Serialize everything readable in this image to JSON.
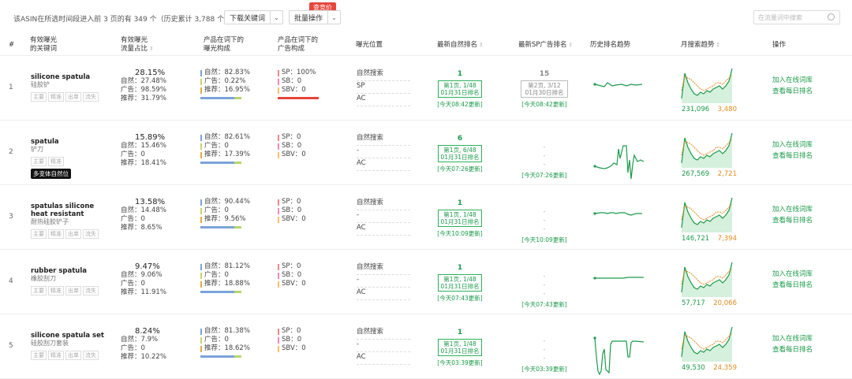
{
  "header": {
    "summary": "该ASIN在所选时间段进入前 3 页的有 349 个（历史累计 3,788 个）",
    "download_label": "下载关键词",
    "batch_label": "批量操作",
    "red_badge": "查竞价",
    "search_placeholder": "在流量词中搜索"
  },
  "columns": {
    "idx": "#",
    "kw_l1": "有效曝光",
    "kw_l2": "的关键词",
    "share_l1": "有效曝光",
    "share_l2": "流量占比",
    "natcomp_l1": "产品在词下的",
    "natcomp_l2": "曝光构成",
    "adcomp_l1": "产品在词下的",
    "adcomp_l2": "广告构成",
    "position": "曝光位置",
    "latest_rank": "最新自然排名",
    "latest_sp": "最新SP广告排名",
    "history": "历史排名趋势",
    "monthly": "月搜索趋势",
    "ops": "操作"
  },
  "colors": {
    "green": "#2bb15a",
    "orange": "#e28a1f",
    "blue": "#7ba3d8",
    "red": "#e8453c"
  },
  "rows": [
    {
      "idx": "1",
      "en": "silicone spatula",
      "cn": "硅胶铲",
      "tags": [
        "主要",
        "精准",
        "出单",
        "流失"
      ],
      "badge": "",
      "share": "28.15%",
      "s_nat": "自然：27.48%",
      "s_ad": "广告：98.59%",
      "s_rec": "推荐：31.79%",
      "n_nat": "自然：82.83%",
      "n_ad": "广告：0.22%",
      "n_rec": "推荐：16.95%",
      "a_sp": "SP：100%",
      "a_sb": "SB：0",
      "a_sbv": "SBV：0",
      "pos1": "自然搜索",
      "pos2": "SP",
      "pos3": "AC",
      "rank_n": "1",
      "rank_box1": "第1页, 1/48",
      "rank_box2": "01月31日排名",
      "rank_upd": "[今天08:42更新]",
      "ad_n": "15",
      "ad_box1": "第2页, 3/12",
      "ad_box2": "01月30日排名",
      "ad_d1": "",
      "ad_d2": "",
      "ad_upd": "[今天08:42更新]",
      "m_a": "231,096",
      "m_b": "3,480",
      "op1": "加入在线词库",
      "op2": "查看每日排名"
    },
    {
      "idx": "2",
      "en": "spatula",
      "cn": "铲刀",
      "tags": [
        "主要",
        "精准"
      ],
      "badge": "多变体自然位",
      "share": "15.89%",
      "s_nat": "自然：15.46%",
      "s_ad": "广告：0",
      "s_rec": "推荐：18.41%",
      "n_nat": "自然：82.61%",
      "n_ad": "广告：0",
      "n_rec": "推荐：17.39%",
      "a_sp": "SP：0",
      "a_sb": "SB：0",
      "a_sbv": "SBV：0",
      "pos1": "自然搜索",
      "pos2": "-",
      "pos3": "AC",
      "rank_n": "6",
      "rank_box1": "第1页, 6/48",
      "rank_box2": "01月31日排名",
      "rank_upd": "[今天07:26更新]",
      "ad_n": "",
      "ad_box1": "",
      "ad_box2": "",
      "ad_d1": "-",
      "ad_d2": "-",
      "ad_upd": "[今天07:26更新]",
      "m_a": "267,569",
      "m_b": "2,721",
      "op1": "加入在线词库",
      "op2": "查看每日排名"
    },
    {
      "idx": "3",
      "en": "spatulas silicone heat resistant",
      "cn": "耐热硅胶铲子",
      "tags": [
        "主要",
        "精准",
        "出单",
        "流失"
      ],
      "badge": "",
      "share": "13.58%",
      "s_nat": "自然：14.48%",
      "s_ad": "广告：0",
      "s_rec": "推荐：8.65%",
      "n_nat": "自然：90.44%",
      "n_ad": "广告：0",
      "n_rec": "推荐：9.56%",
      "a_sp": "SP：0",
      "a_sb": "SB：0",
      "a_sbv": "SBV：0",
      "pos1": "自然搜索",
      "pos2": "-",
      "pos3": "AC",
      "rank_n": "1",
      "rank_box1": "第1页, 1/48",
      "rank_box2": "01月31日排名",
      "rank_upd": "[今天10:09更新]",
      "ad_n": "",
      "ad_box1": "",
      "ad_box2": "",
      "ad_d1": "-",
      "ad_d2": "-",
      "ad_upd": "[今天10:09更新]",
      "m_a": "146,721",
      "m_b": "7,394",
      "op1": "加入在线词库",
      "op2": "查看每日排名"
    },
    {
      "idx": "4",
      "en": "rubber spatula",
      "cn": "橡胶刮刀",
      "tags": [
        "主要",
        "精准",
        "出单",
        "流失"
      ],
      "badge": "",
      "share": "9.47%",
      "s_nat": "自然：9.06%",
      "s_ad": "广告：0",
      "s_rec": "推荐：11.91%",
      "n_nat": "自然：81.12%",
      "n_ad": "广告：0",
      "n_rec": "推荐：18.88%",
      "a_sp": "SP：0",
      "a_sb": "SB：0",
      "a_sbv": "SBV：0",
      "pos1": "自然搜索",
      "pos2": "-",
      "pos3": "AC",
      "rank_n": "1",
      "rank_box1": "第1页, 1/48",
      "rank_box2": "01月31日排名",
      "rank_upd": "[今天07:43更新]",
      "ad_n": "",
      "ad_box1": "",
      "ad_box2": "",
      "ad_d1": "-",
      "ad_d2": "-",
      "ad_upd": "[今天07:43更新]",
      "m_a": "57,717",
      "m_b": "20,066",
      "op1": "加入在线词库",
      "op2": "查看每日排名"
    },
    {
      "idx": "5",
      "en": "silicone spatula set",
      "cn": "硅胶刮刀套装",
      "tags": [
        "主要",
        "精准",
        "出单",
        "流失"
      ],
      "badge": "",
      "share": "8.24%",
      "s_nat": "自然：7.9%",
      "s_ad": "广告：0",
      "s_rec": "推荐：10.22%",
      "n_nat": "自然：81.38%",
      "n_ad": "广告：0",
      "n_rec": "推荐：18.62%",
      "a_sp": "SP：0",
      "a_sb": "SB：0",
      "a_sbv": "SBV：0",
      "pos1": "自然搜索",
      "pos2": "-",
      "pos3": "AC",
      "rank_n": "1",
      "rank_box1": "第1页, 1/48",
      "rank_box2": "01月31日排名",
      "rank_upd": "[今天03:39更新]",
      "ad_n": "",
      "ad_box1": "",
      "ad_box2": "",
      "ad_d1": "-",
      "ad_d2": "-",
      "ad_upd": "[今天03:39更新]",
      "m_a": "49,530",
      "m_b": "24,359",
      "op1": "加入在线词库",
      "op2": "查看每日排名"
    }
  ]
}
